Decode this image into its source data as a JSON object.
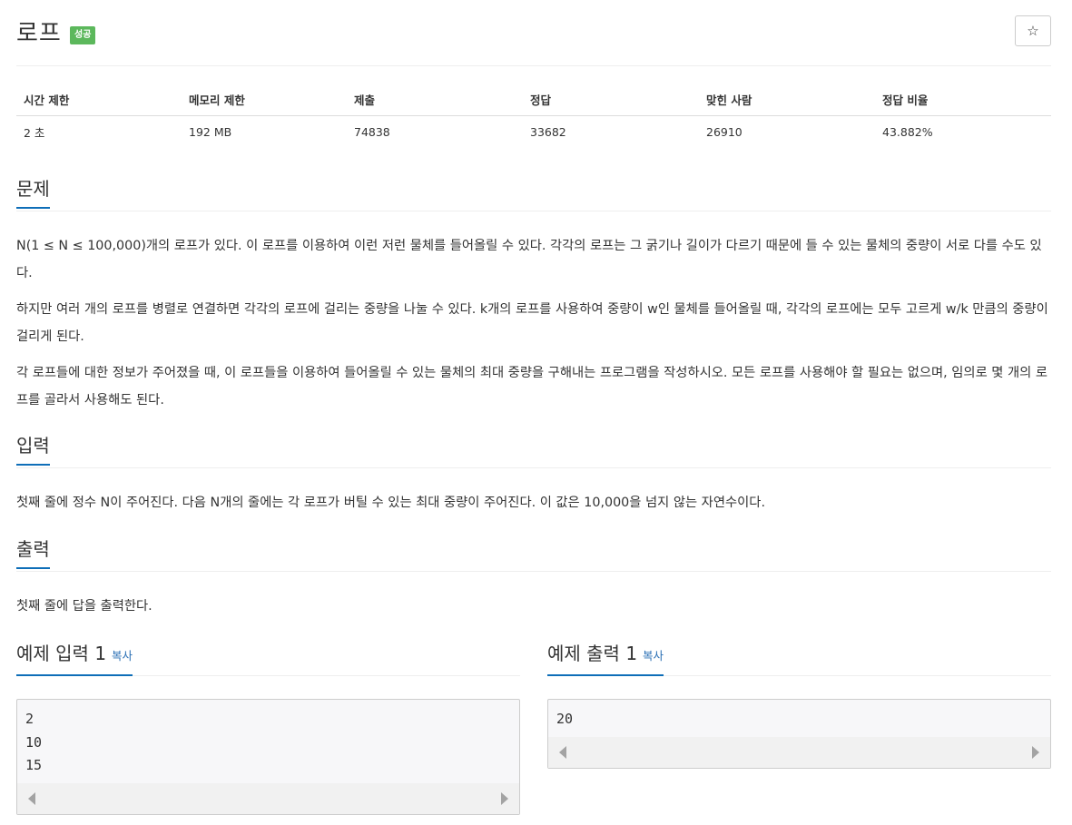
{
  "problem": {
    "title": "로프",
    "badge": "성공",
    "star_icon": "☆"
  },
  "info_table": {
    "headers": [
      "시간 제한",
      "메모리 제한",
      "제출",
      "정답",
      "맞힌 사람",
      "정답 비율"
    ],
    "values": [
      "2 초",
      "192 MB",
      "74838",
      "33682",
      "26910",
      "43.882%"
    ]
  },
  "sections": {
    "description": {
      "title": "문제",
      "paragraphs": [
        "N(1 ≤ N ≤ 100,000)개의 로프가 있다. 이 로프를 이용하여 이런 저런 물체를 들어올릴 수 있다. 각각의 로프는 그 굵기나 길이가 다르기 때문에 들 수 있는 물체의 중량이 서로 다를 수도 있다.",
        "하지만 여러 개의 로프를 병렬로 연결하면 각각의 로프에 걸리는 중량을 나눌 수 있다. k개의 로프를 사용하여 중량이 w인 물체를 들어올릴 때, 각각의 로프에는 모두 고르게 w/k 만큼의 중량이 걸리게 된다.",
        "각 로프들에 대한 정보가 주어졌을 때, 이 로프들을 이용하여 들어올릴 수 있는 물체의 최대 중량을 구해내는 프로그램을 작성하시오. 모든 로프를 사용해야 할 필요는 없으며, 임의로 몇 개의 로프를 골라서 사용해도 된다."
      ]
    },
    "input": {
      "title": "입력",
      "text": "첫째 줄에 정수 N이 주어진다. 다음 N개의 줄에는 각 로프가 버틸 수 있는 최대 중량이 주어진다. 이 값은 10,000을 넘지 않는 자연수이다."
    },
    "output": {
      "title": "출력",
      "text": "첫째 줄에 답을 출력한다."
    }
  },
  "samples": {
    "input": {
      "title": "예제 입력 1",
      "copy_label": "복사",
      "content": "2\n10\n15"
    },
    "output": {
      "title": "예제 출력 1",
      "copy_label": "복사",
      "content": "20"
    }
  },
  "colors": {
    "badge": "#5cb85c",
    "headline_underline": "#0e6eb8",
    "copy_link": "#2b70b5"
  }
}
